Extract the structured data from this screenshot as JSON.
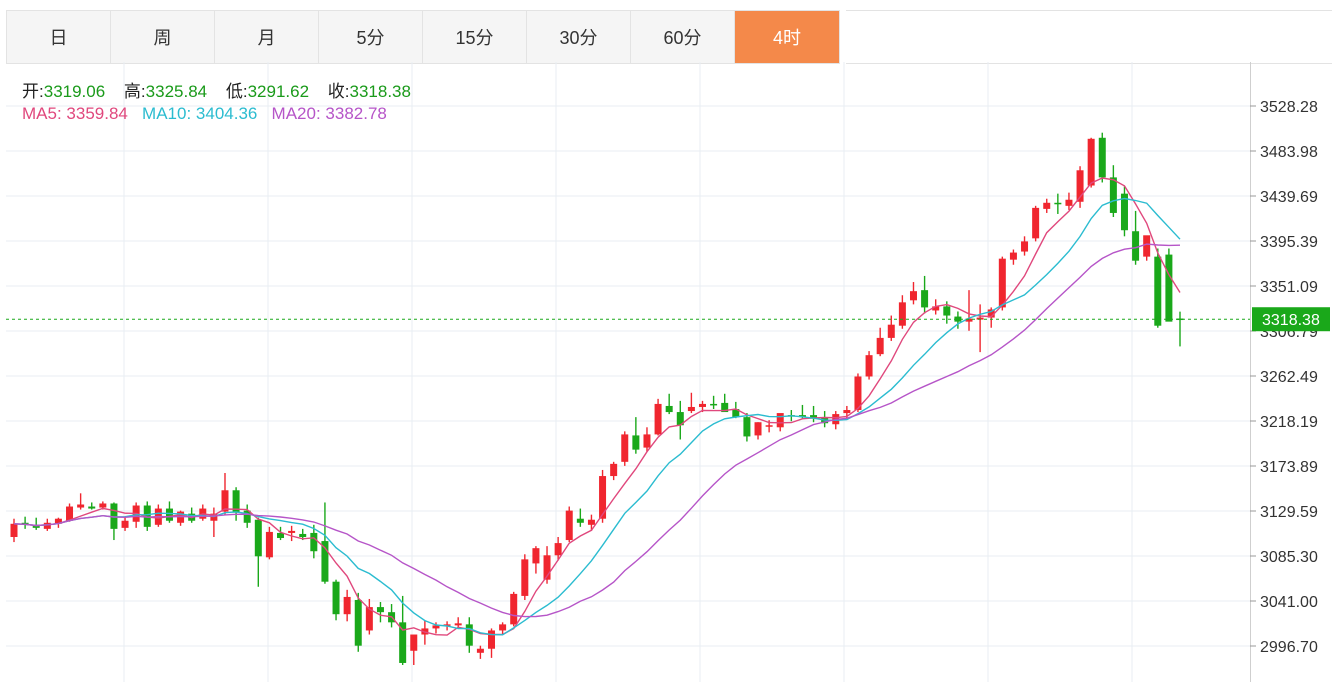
{
  "tabs": [
    "日",
    "周",
    "月",
    "5分",
    "15分",
    "30分",
    "60分",
    "4时"
  ],
  "active_tab": 7,
  "ohlc": {
    "open_label": "开:",
    "open": "3319.06",
    "high_label": "高:",
    "high": "3325.84",
    "low_label": "低:",
    "low": "3291.62",
    "close_label": "收:",
    "close": "3318.38"
  },
  "ma": {
    "ma5_label": "MA5:",
    "ma5": "3359.84",
    "ma10_label": "MA10:",
    "ma10": "3404.36",
    "ma20_label": "MA20:",
    "ma20": "3382.78"
  },
  "colors": {
    "up": "#f0262f",
    "down": "#1aa81a",
    "ma5": "#e0487d",
    "ma10": "#2bbcd0",
    "ma20": "#b655c8",
    "active_tab": "#f4894a",
    "last_price": "#1aa81a"
  },
  "chart_data": {
    "type": "candlestick",
    "y_ticks": [
      "3528.28",
      "3483.98",
      "3439.69",
      "3395.39",
      "3351.09",
      "3306.79",
      "3262.49",
      "3218.19",
      "3173.89",
      "3129.59",
      "3085.30",
      "3041.00",
      "2996.70"
    ],
    "ylim": [
      2965,
      3575
    ],
    "last_price": "3318.38",
    "candles": [
      [
        3104,
        3122,
        3099,
        3117
      ],
      [
        3118,
        3124,
        3112,
        3116
      ],
      [
        3116,
        3123,
        3111,
        3113
      ],
      [
        3112,
        3122,
        3110,
        3118
      ],
      [
        3117,
        3123,
        3113,
        3122
      ],
      [
        3120,
        3137,
        3119,
        3134
      ],
      [
        3133,
        3147,
        3131,
        3136
      ],
      [
        3134,
        3138,
        3131,
        3132
      ],
      [
        3133,
        3139,
        3131,
        3137
      ],
      [
        3137,
        3138,
        3101,
        3112
      ],
      [
        3113,
        3124,
        3110,
        3120
      ],
      [
        3119,
        3138,
        3113,
        3135
      ],
      [
        3135,
        3139,
        3110,
        3114
      ],
      [
        3116,
        3136,
        3114,
        3132
      ],
      [
        3132,
        3139,
        3118,
        3120
      ],
      [
        3118,
        3130,
        3115,
        3129
      ],
      [
        3127,
        3133,
        3118,
        3120
      ],
      [
        3122,
        3136,
        3120,
        3132
      ],
      [
        3120,
        3133,
        3104,
        3127
      ],
      [
        3129,
        3167,
        3126,
        3150
      ],
      [
        3150,
        3153,
        3120,
        3128
      ],
      [
        3130,
        3136,
        3113,
        3118
      ],
      [
        3121,
        3123,
        3055,
        3085
      ],
      [
        3084,
        3114,
        3082,
        3109
      ],
      [
        3108,
        3114,
        3101,
        3103
      ],
      [
        3108,
        3115,
        3100,
        3110
      ],
      [
        3107,
        3112,
        3101,
        3104
      ],
      [
        3108,
        3116,
        3083,
        3090
      ],
      [
        3100,
        3138,
        3058,
        3060
      ],
      [
        3060,
        3062,
        3022,
        3028
      ],
      [
        3028,
        3052,
        3021,
        3045
      ],
      [
        3042,
        3049,
        2991,
        2997
      ],
      [
        3012,
        3043,
        3008,
        3035
      ],
      [
        3035,
        3040,
        3020,
        3030
      ],
      [
        3030,
        3038,
        3015,
        3020
      ],
      [
        3020,
        3046,
        2978,
        2980
      ],
      [
        2992,
        3005,
        2978,
        3008
      ],
      [
        3008,
        3022,
        2998,
        3014
      ],
      [
        3014,
        3020,
        3009,
        3017
      ],
      [
        3017,
        3021,
        3012,
        3018
      ],
      [
        3017,
        3025,
        3014,
        3019
      ],
      [
        3018,
        3025,
        2990,
        2997
      ],
      [
        2990,
        2997,
        2984,
        2994
      ],
      [
        2994,
        3014,
        2985,
        3012
      ],
      [
        3012,
        3020,
        3008,
        3018
      ],
      [
        3018,
        3050,
        3016,
        3048
      ],
      [
        3046,
        3087,
        3042,
        3082
      ],
      [
        3078,
        3095,
        3068,
        3093
      ],
      [
        3062,
        3095,
        3058,
        3086
      ],
      [
        3086,
        3104,
        3081,
        3098
      ],
      [
        3101,
        3134,
        3099,
        3130
      ],
      [
        3122,
        3132,
        3114,
        3118
      ],
      [
        3116,
        3126,
        3110,
        3121
      ],
      [
        3122,
        3170,
        3118,
        3164
      ],
      [
        3164,
        3178,
        3160,
        3176
      ],
      [
        3178,
        3208,
        3174,
        3205
      ],
      [
        3204,
        3222,
        3186,
        3190
      ],
      [
        3192,
        3212,
        3188,
        3205
      ],
      [
        3205,
        3240,
        3204,
        3235
      ],
      [
        3233,
        3245,
        3225,
        3227
      ],
      [
        3227,
        3238,
        3200,
        3214
      ],
      [
        3228,
        3246,
        3226,
        3232
      ],
      [
        3232,
        3238,
        3227,
        3235
      ],
      [
        3235,
        3243,
        3230,
        3234
      ],
      [
        3236,
        3245,
        3228,
        3227
      ],
      [
        3230,
        3237,
        3221,
        3222
      ],
      [
        3222,
        3226,
        3198,
        3203
      ],
      [
        3204,
        3217,
        3200,
        3217
      ],
      [
        3214,
        3219,
        3207,
        3214
      ],
      [
        3212,
        3224,
        3208,
        3226
      ],
      [
        3224,
        3229,
        3218,
        3223
      ],
      [
        3224,
        3234,
        3220,
        3222
      ],
      [
        3224,
        3233,
        3217,
        3221
      ],
      [
        3222,
        3228,
        3212,
        3216
      ],
      [
        3215,
        3228,
        3210,
        3225
      ],
      [
        3226,
        3233,
        3221,
        3229
      ],
      [
        3229,
        3265,
        3227,
        3262
      ],
      [
        3262,
        3287,
        3259,
        3283
      ],
      [
        3284,
        3310,
        3282,
        3300
      ],
      [
        3300,
        3322,
        3297,
        3313
      ],
      [
        3312,
        3342,
        3309,
        3335
      ],
      [
        3337,
        3355,
        3333,
        3346
      ],
      [
        3347,
        3361,
        3324,
        3330
      ],
      [
        3327,
        3338,
        3323,
        3331
      ],
      [
        3331,
        3336,
        3314,
        3322
      ],
      [
        3321,
        3326,
        3309,
        3316
      ],
      [
        3316,
        3347,
        3307,
        3319
      ],
      [
        3318,
        3333,
        3286,
        3320
      ],
      [
        3320,
        3330,
        3310,
        3328
      ],
      [
        3330,
        3380,
        3327,
        3378
      ],
      [
        3377,
        3387,
        3372,
        3384
      ],
      [
        3385,
        3400,
        3381,
        3395
      ],
      [
        3398,
        3430,
        3395,
        3428
      ],
      [
        3427,
        3437,
        3423,
        3433
      ],
      [
        3433,
        3442,
        3422,
        3432
      ],
      [
        3430,
        3443,
        3426,
        3436
      ],
      [
        3434,
        3469,
        3428,
        3465
      ],
      [
        3450,
        3497,
        3448,
        3496
      ],
      [
        3497,
        3502,
        3453,
        3458
      ],
      [
        3458,
        3470,
        3419,
        3423
      ],
      [
        3442,
        3449,
        3400,
        3406
      ],
      [
        3405,
        3425,
        3372,
        3376
      ],
      [
        3380,
        3400,
        3376,
        3401
      ],
      [
        3380,
        3388,
        3310,
        3312
      ],
      [
        3382,
        3388,
        3318,
        3316
      ],
      [
        3319.06,
        3325.84,
        3291.62,
        3318.38
      ]
    ]
  }
}
